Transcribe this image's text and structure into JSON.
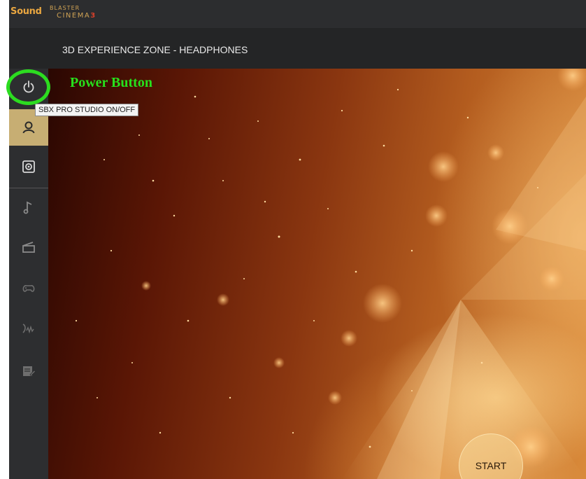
{
  "app": {
    "logo_sound": "Sound",
    "logo_blaster": "BLASTER",
    "logo_cinema": "CINEMA",
    "logo_version": "3",
    "brand_color": "#e9a640"
  },
  "header": {
    "title": "3D EXPERIENCE ZONE - HEADPHONES"
  },
  "sidebar": {
    "items": [
      {
        "name": "power",
        "icon": "power-icon",
        "active": false
      },
      {
        "name": "profile",
        "icon": "user-icon",
        "active": true
      },
      {
        "name": "speaker",
        "icon": "speaker-icon",
        "active": false
      },
      {
        "name": "music",
        "icon": "music-note-icon",
        "active": false
      },
      {
        "name": "movie",
        "icon": "clapperboard-icon",
        "active": false
      },
      {
        "name": "game",
        "icon": "gamepad-icon",
        "active": false
      },
      {
        "name": "voice",
        "icon": "voice-icon",
        "active": false
      },
      {
        "name": "edit",
        "icon": "edit-icon",
        "active": false
      }
    ],
    "active_color": "#c7ae73"
  },
  "tooltip": {
    "text": "SBX PRO STUDIO ON/OFF"
  },
  "main": {
    "start_label": "START"
  },
  "annotation": {
    "label": "Power Button",
    "color": "#27e01c"
  }
}
